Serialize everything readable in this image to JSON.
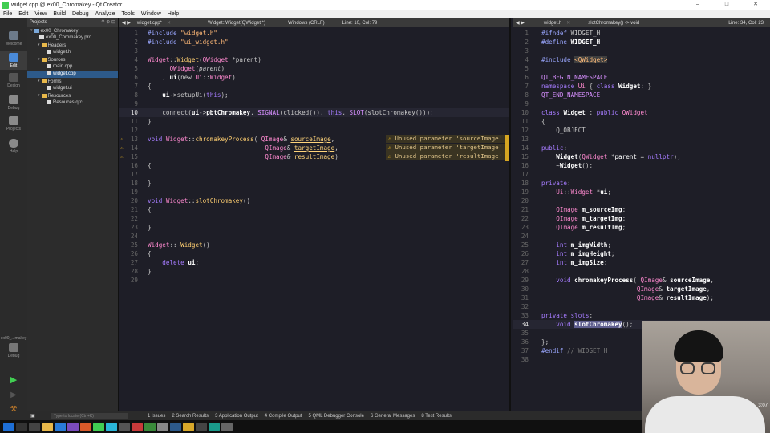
{
  "window": {
    "title": "widget.cpp @ ex00_Chromakey - Qt Creator",
    "min": "–",
    "max": "□",
    "close": "✕"
  },
  "menu": [
    "File",
    "Edit",
    "View",
    "Build",
    "Debug",
    "Analyze",
    "Tools",
    "Window",
    "Help"
  ],
  "modes": [
    {
      "label": "Welcome",
      "icon": "grid-icon"
    },
    {
      "label": "Edit",
      "icon": "edit-icon"
    },
    {
      "label": "Design",
      "icon": "pen-icon"
    },
    {
      "label": "Debug",
      "icon": "bug-icon"
    },
    {
      "label": "Projects",
      "icon": "wrench-icon"
    },
    {
      "label": "Help",
      "icon": "help-icon"
    }
  ],
  "kit": {
    "label": "ex00_...makey",
    "mode": "Debug"
  },
  "project_pane": {
    "title": "Projects",
    "items": [
      {
        "label": "ex00_Chromakey",
        "kind": "proj",
        "level": 0
      },
      {
        "label": "ex00_Chromakey.pro",
        "kind": "file",
        "level": 1
      },
      {
        "label": "Headers",
        "kind": "folder",
        "level": 1
      },
      {
        "label": "widget.h",
        "kind": "file",
        "level": 2
      },
      {
        "label": "Sources",
        "kind": "folder",
        "level": 1
      },
      {
        "label": "main.cpp",
        "kind": "file",
        "level": 2
      },
      {
        "label": "widget.cpp",
        "kind": "file",
        "level": 2,
        "selected": true
      },
      {
        "label": "Forms",
        "kind": "folder",
        "level": 1
      },
      {
        "label": "widget.ui",
        "kind": "file",
        "level": 2
      },
      {
        "label": "Resources",
        "kind": "folder",
        "level": 1
      },
      {
        "label": "Resouces.qrc",
        "kind": "file",
        "level": 2
      }
    ]
  },
  "left_editor": {
    "file": "widget.cpp*",
    "symbol": "Widget::Widget(QWidget *)",
    "encoding": "Windows (CRLF)",
    "position": "Line: 10, Col: 79",
    "warning_text": "Unused parameter",
    "warnings": [
      "'sourceImage'",
      "'targetImage'",
      "'resultImage'"
    ]
  },
  "right_editor": {
    "file": "widget.h",
    "symbol": "slotChromakey() -> void",
    "position": "Line: 34, Col: 23"
  },
  "output_bar": {
    "locator_placeholder": "Type to locate (Ctrl+K)",
    "tabs": [
      "1 Issues",
      "2 Search Results",
      "3 Application Output",
      "4 Compile Output",
      "5 QML Debugger Console",
      "6 General Messages",
      "8 Test Results"
    ]
  },
  "webcam": {
    "clock": "3:07"
  },
  "colors": {
    "warning": "#d6a621",
    "selection": "#2d5a8a",
    "editor_bg": "#1e1e27"
  }
}
